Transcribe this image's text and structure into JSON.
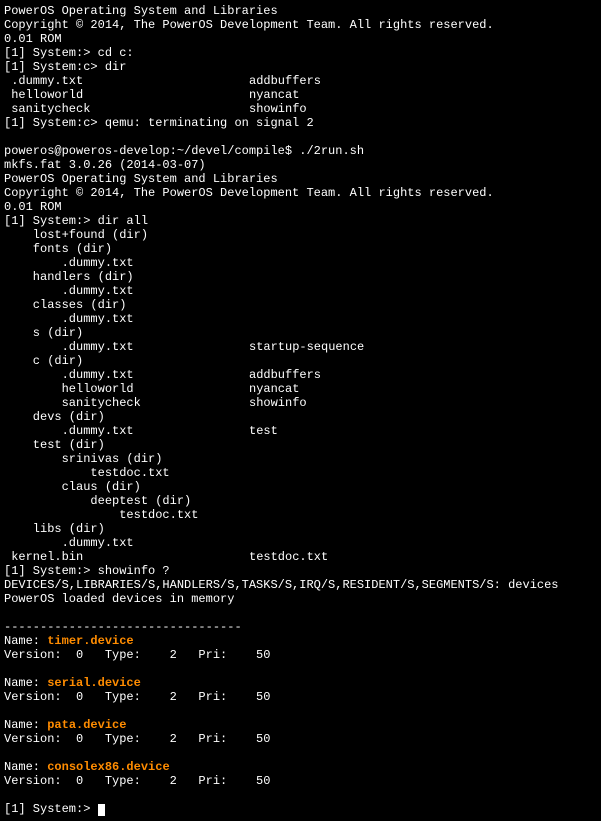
{
  "header1": {
    "title": "PowerOS Operating System and Libraries",
    "copyright": "Copyright © 2014, The PowerOS Development Team. All rights reserved.",
    "rom": "0.01 ROM"
  },
  "session1": {
    "prompt1": "[1] System:> ",
    "cmd1": "cd c:",
    "prompt2": "[1] System:c> ",
    "cmd2": "dir",
    "files": [
      {
        "c1": " .dummy.txt",
        "c2": "addbuffers"
      },
      {
        "c1": " helloworld",
        "c2": "nyancat"
      },
      {
        "c1": " sanitycheck",
        "c2": "showinfo"
      }
    ],
    "prompt3": "[1] System:c> ",
    "cmd3": "qemu: terminating on signal 2"
  },
  "shell": {
    "prompt": "poweros@poweros-develop:~/devel/compile$ ",
    "cmd": "./2run.sh",
    "mkfs": "mkfs.fat 3.0.26 (2014-03-07)"
  },
  "header2": {
    "title": "PowerOS Operating System and Libraries",
    "copyright": "Copyright © 2014, The PowerOS Development Team. All rights reserved.",
    "rom": "0.01 ROM"
  },
  "session2": {
    "prompt": "[1] System:> ",
    "cmd": "dir all",
    "tree": [
      {
        "c1": "    lost+found (dir)"
      },
      {
        "c1": "    fonts (dir)"
      },
      {
        "c1": "        .dummy.txt"
      },
      {
        "c1": "    handlers (dir)"
      },
      {
        "c1": "        .dummy.txt"
      },
      {
        "c1": "    classes (dir)"
      },
      {
        "c1": "        .dummy.txt"
      },
      {
        "c1": "    s (dir)"
      },
      {
        "c1": "        .dummy.txt",
        "c2": "startup-sequence"
      },
      {
        "c1": "    c (dir)"
      },
      {
        "c1": "        .dummy.txt",
        "c2": "addbuffers"
      },
      {
        "c1": "        helloworld",
        "c2": "nyancat"
      },
      {
        "c1": "        sanitycheck",
        "c2": "showinfo"
      },
      {
        "c1": "    devs (dir)"
      },
      {
        "c1": "        .dummy.txt",
        "c2": "test"
      },
      {
        "c1": "    test (dir)"
      },
      {
        "c1": "        srinivas (dir)"
      },
      {
        "c1": "            testdoc.txt"
      },
      {
        "c1": "        claus (dir)"
      },
      {
        "c1": "            deeptest (dir)"
      },
      {
        "c1": "                testdoc.txt"
      },
      {
        "c1": "    libs (dir)"
      },
      {
        "c1": "        .dummy.txt"
      },
      {
        "c1": " kernel.bin",
        "c2": "testdoc.txt"
      }
    ]
  },
  "session3": {
    "prompt": "[1] System:> ",
    "cmd": "showinfo ?",
    "opts": "DEVICES/S,LIBRARIES/S,HANDLERS/S,TASKS/S,IRQ/S,RESIDENT/S,SEGMENTS/S: ",
    "opts_in": "devices",
    "result": "PowerOS loaded devices in memory",
    "sep": "---------------------------------"
  },
  "devices": [
    {
      "name_label": "Name: ",
      "name": "timer.device",
      "ver_label": "Version:",
      "ver": "0",
      "type_label": "Type:",
      "type": "2",
      "pri_label": "Pri:",
      "pri": "50"
    },
    {
      "name_label": "Name: ",
      "name": "serial.device",
      "ver_label": "Version:",
      "ver": "0",
      "type_label": "Type:",
      "type": "2",
      "pri_label": "Pri:",
      "pri": "50"
    },
    {
      "name_label": "Name: ",
      "name": "pata.device",
      "ver_label": "Version:",
      "ver": "0",
      "type_label": "Type:",
      "type": "2",
      "pri_label": "Pri:",
      "pri": "50"
    },
    {
      "name_label": "Name: ",
      "name": "consolex86.device",
      "ver_label": "Version:",
      "ver": "0",
      "type_label": "Type:",
      "type": "2",
      "pri_label": "Pri:",
      "pri": "50"
    }
  ],
  "final_prompt": "[1] System:> "
}
